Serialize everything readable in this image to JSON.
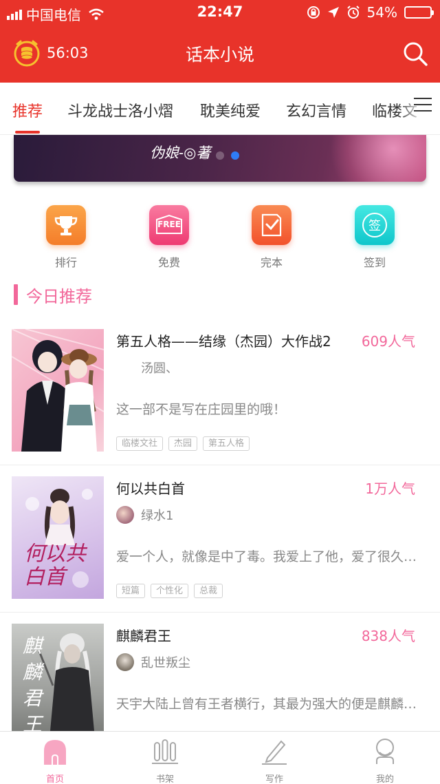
{
  "status_bar": {
    "carrier": "中国电信",
    "time": "22:47",
    "battery_percent": "54%",
    "battery_level": 0.54
  },
  "header": {
    "timer": "56:03",
    "title": "话本小说"
  },
  "tabs": [
    {
      "label": "推荐",
      "active": true
    },
    {
      "label": "斗龙战士洛小熠",
      "active": false
    },
    {
      "label": "耽美纯爱",
      "active": false
    },
    {
      "label": "玄幻言情",
      "active": false
    },
    {
      "label": "临楼文",
      "active": false
    }
  ],
  "banner": {
    "author_text": "伪娘-◎著",
    "dot_count": 3,
    "active_dot": 2
  },
  "quick_entries": [
    {
      "label": "排行",
      "icon": "trophy-icon",
      "color": "#f7923a"
    },
    {
      "label": "免费",
      "icon": "free-icon",
      "color": "#f0437b",
      "badge": "FREE"
    },
    {
      "label": "完本",
      "icon": "check-book-icon",
      "color": "#f5683a"
    },
    {
      "label": "签到",
      "icon": "checkin-icon",
      "color": "#16d3d0",
      "badge": "签"
    }
  ],
  "section": {
    "title": "今日推荐"
  },
  "books": [
    {
      "title": "第五人格——结缘（杰园）大作战2",
      "popularity": "609人气",
      "author": "汤圆、",
      "description": "这一部不是写在庄园里的哦！",
      "tags": [
        "临楼文社",
        "杰园",
        "第五人格"
      ]
    },
    {
      "title": "何以共白首",
      "popularity": "1万人气",
      "author": "绿水1",
      "description": "爱一个人，就像是中了毒。我爱上了他，爱了很久很久",
      "tags": [
        "短篇",
        "个性化",
        "总裁"
      ],
      "cover_text": "何以共白首"
    },
    {
      "title": "麒麟君王",
      "popularity": "838人气",
      "author": "乱世叛尘",
      "description": "天宇大陆上曾有王者横行，其最为强大的便是麒麟君王",
      "tags": [],
      "cover_text": "麒麟君王"
    }
  ],
  "bottom_nav": [
    {
      "label": "首页",
      "icon": "home-icon",
      "active": true
    },
    {
      "label": "书架",
      "icon": "bookshelf-icon",
      "active": false
    },
    {
      "label": "写作",
      "icon": "pen-icon",
      "active": false
    },
    {
      "label": "我的",
      "icon": "profile-icon",
      "active": false
    }
  ],
  "colors": {
    "brand_red": "#e8332a",
    "accent_pink": "#f2679a",
    "active_dot": "#2f7cf6"
  }
}
